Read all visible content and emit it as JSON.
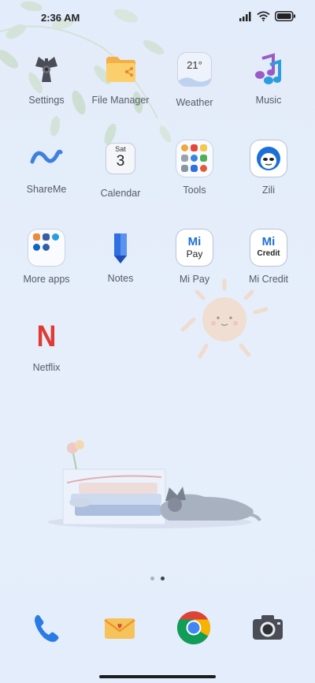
{
  "status_bar": {
    "time": "2:36 AM",
    "icons": [
      "signal-icon",
      "wifi-icon",
      "battery-icon"
    ]
  },
  "apps": {
    "settings": "Settings",
    "file_manager": "File Manager",
    "weather": "Weather",
    "weather_temp": "21°",
    "music": "Music",
    "shareme": "ShareMe",
    "calendar": "Calendar",
    "calendar_day": "Sat",
    "calendar_date": "3",
    "tools": "Tools",
    "zili": "Zili",
    "more_apps": "More apps",
    "notes": "Notes",
    "mi_pay": "Mi Pay",
    "mi_pay_mi": "Mi",
    "mi_pay_pay": "Pay",
    "mi_credit": "Mi Credit",
    "mi_credit_mi": "Mi",
    "mi_credit_credit": "Credit",
    "netflix": "Netflix",
    "netflix_letter": "N"
  },
  "page_indicator": {
    "pages": 2,
    "current": 2
  },
  "dock": [
    "phone-icon",
    "messages-icon",
    "chrome-icon",
    "camera-icon"
  ],
  "colors": {
    "background": "#e4edfb",
    "label": "#555c66",
    "netflix_red": "#e03a32",
    "accent_blue": "#2f6fe0"
  }
}
